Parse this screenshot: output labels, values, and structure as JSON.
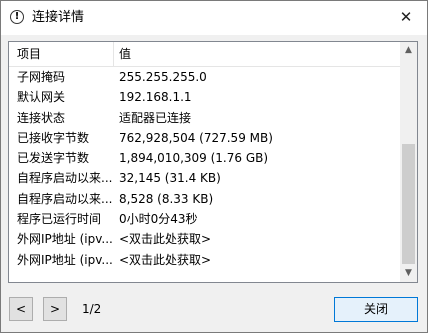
{
  "window": {
    "title": "连接详情",
    "close_glyph": "✕",
    "info_glyph": "!"
  },
  "table": {
    "columns": [
      "项目",
      "值"
    ],
    "rows": [
      {
        "item": "子网掩码",
        "value": "255.255.255.0"
      },
      {
        "item": "默认网关",
        "value": "192.168.1.1"
      },
      {
        "item": "连接状态",
        "value": "适配器已连接"
      },
      {
        "item": "已接收字节数",
        "value": "762,928,504 (727.59 MB)"
      },
      {
        "item": "已发送字节数",
        "value": "1,894,010,309 (1.76 GB)"
      },
      {
        "item": "自程序启动以来...",
        "value": "32,145 (31.4 KB)"
      },
      {
        "item": "自程序启动以来...",
        "value": "8,528 (8.33 KB)"
      },
      {
        "item": "程序已运行时间",
        "value": "0小时0分43秒"
      },
      {
        "item": "外网IP地址 (ipv...",
        "value": "<双击此处获取>"
      },
      {
        "item": "外网IP地址 (ipv...",
        "value": "<双击此处获取>"
      }
    ]
  },
  "scrollbar": {
    "up": "▲",
    "down": "▼"
  },
  "footer": {
    "prev_label": "<",
    "next_label": ">",
    "page_indicator": "1/2",
    "close_label": "关闭"
  }
}
